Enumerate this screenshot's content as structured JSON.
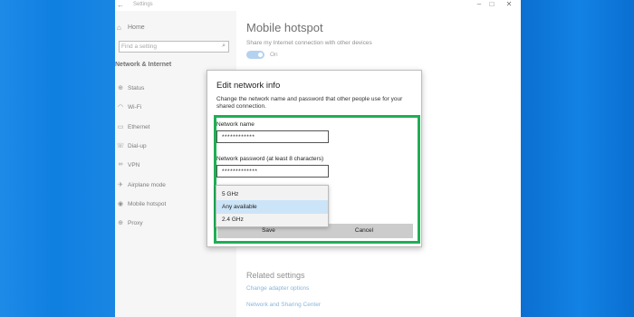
{
  "window": {
    "title": "Settings",
    "back_icon": "back-arrow-icon",
    "controls": [
      "–",
      "□",
      "✕"
    ]
  },
  "sidebar": {
    "home_label": "Home",
    "search_placeholder": "Find a setting",
    "section_title": "Network & Internet",
    "items": [
      {
        "label": "Status",
        "icon": "globe-icon"
      },
      {
        "label": "Wi-Fi",
        "icon": "wifi-icon"
      },
      {
        "label": "Ethernet",
        "icon": "ethernet-icon"
      },
      {
        "label": "Dial-up",
        "icon": "phone-icon"
      },
      {
        "label": "VPN",
        "icon": "vpn-icon"
      },
      {
        "label": "Airplane mode",
        "icon": "airplane-icon"
      },
      {
        "label": "Mobile hotspot",
        "icon": "hotspot-icon"
      },
      {
        "label": "Proxy",
        "icon": "globe-icon"
      }
    ]
  },
  "main": {
    "title": "Mobile hotspot",
    "description": "Share my Internet connection with other devices",
    "toggle_state": "On",
    "toggle_on": true,
    "related_title": "Related settings",
    "related_links": [
      "Change adapter options",
      "Network and Sharing Center"
    ]
  },
  "dialog": {
    "title": "Edit network info",
    "description": "Change the network name and password that other people use for your shared connection.",
    "network_name_label": "Network name",
    "network_name_value": "************",
    "password_label": "Network password (at least 8 characters)",
    "password_value": "*************",
    "save_label": "Save",
    "cancel_label": "Cancel",
    "highlight_color": "#1fae55"
  },
  "band_dropdown": {
    "options": [
      "5 GHz",
      "Any available",
      "2.4 GHz"
    ],
    "selected": "Any available"
  }
}
